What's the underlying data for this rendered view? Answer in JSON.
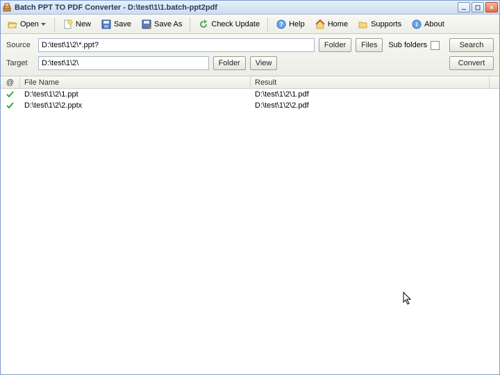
{
  "window": {
    "title": "Batch PPT TO PDF Converter - D:\\test\\1\\1.batch-ppt2pdf"
  },
  "toolbar": {
    "open": "Open",
    "new": "New",
    "save": "Save",
    "save_as": "Save As",
    "check_update": "Check Update",
    "help": "Help",
    "home": "Home",
    "supports": "Supports",
    "about": "About"
  },
  "paths": {
    "source_label": "Source",
    "source_value": "D:\\test\\1\\2\\*.ppt?",
    "target_label": "Target",
    "target_value": "D:\\test\\1\\2\\",
    "folder_btn": "Folder",
    "files_btn": "Files",
    "view_btn": "View",
    "sub_folders_label": "Sub folders",
    "search_btn": "Search",
    "convert_btn": "Convert"
  },
  "list": {
    "header_status": "@",
    "header_filename": "File Name",
    "header_result": "Result",
    "rows": [
      {
        "status": "ok",
        "filename": "D:\\test\\1\\2\\1.ppt",
        "result": "D:\\test\\1\\2\\1.pdf"
      },
      {
        "status": "ok",
        "filename": "D:\\test\\1\\2\\2.pptx",
        "result": "D:\\test\\1\\2\\2.pdf"
      }
    ]
  },
  "icons": {
    "open": "open-folder-icon",
    "new": "new-document-icon",
    "save": "floppy-icon",
    "save_as": "floppy-pencil-icon",
    "check_update": "refresh-icon",
    "help": "help-icon",
    "home": "home-icon",
    "supports": "folder-icon",
    "about": "info-icon",
    "app": "stack-icon",
    "ok": "green-check-icon",
    "dropdown": "chevron-down-icon"
  }
}
